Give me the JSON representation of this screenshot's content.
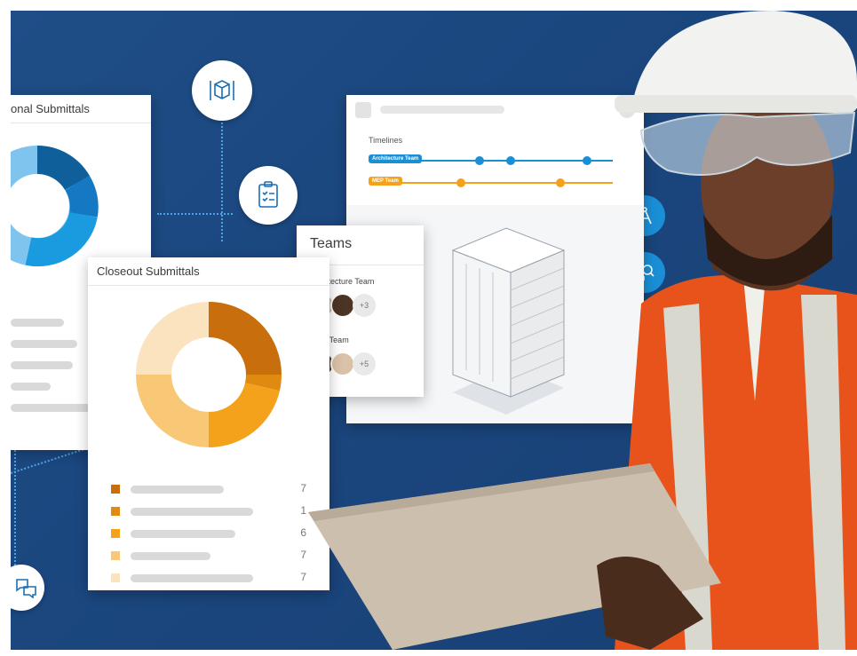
{
  "colors": {
    "background": "#1b477f",
    "accent_blue": "#1a8fd6",
    "accent_orange": "#f4a21c"
  },
  "left_card": {
    "title": "onal Submittals"
  },
  "closeout_card": {
    "title": "Closeout Submittals",
    "legend_values": [
      "7",
      "1",
      "6",
      "7",
      "7"
    ]
  },
  "teams_card": {
    "title": "Teams",
    "teams": [
      {
        "name": "Architecture Team",
        "extra": "+3"
      },
      {
        "name": "MEP Team",
        "extra": "+5"
      }
    ]
  },
  "timeline_card": {
    "heading": "Timelines",
    "rows": [
      {
        "label": "Architecture Team"
      },
      {
        "label": "MEP Team"
      }
    ]
  },
  "icons": [
    "building-cube-icon",
    "checklist-icon",
    "chat-icon",
    "compass-icon",
    "chart-magnifier-icon",
    "message-icon"
  ],
  "chart_data": [
    {
      "type": "pie",
      "title": "Closeout Submittals",
      "values": [
        7,
        1,
        6,
        7,
        7
      ],
      "colors": [
        "#c86e0c",
        "#e08a10",
        "#f4a21c",
        "#f8c876",
        "#fbe3bf"
      ]
    }
  ]
}
